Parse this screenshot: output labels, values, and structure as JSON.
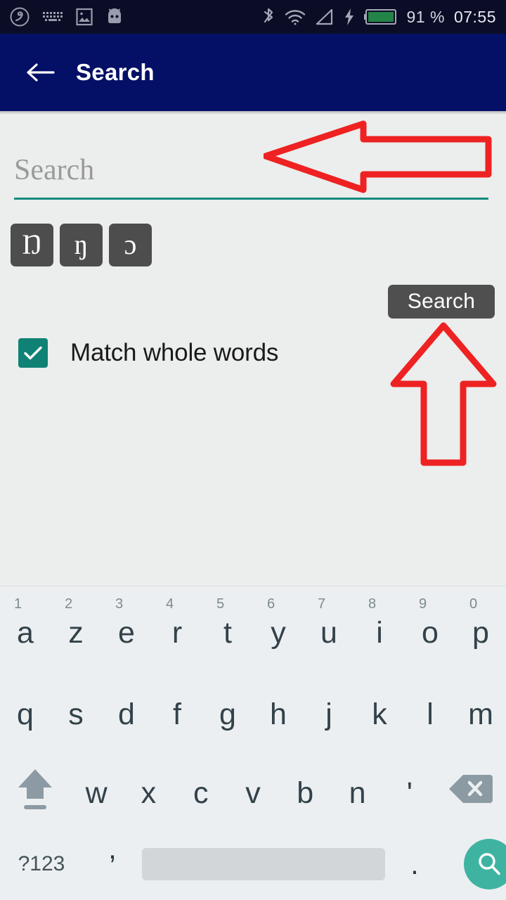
{
  "status_bar": {
    "left_icons": [
      "app-swirl-icon",
      "keyboard-icon",
      "image-icon",
      "android-head-icon"
    ],
    "right_icons": [
      "bluetooth-icon",
      "wifi-icon",
      "signal-icon",
      "charging-bolt-icon",
      "battery-icon"
    ],
    "battery_percent": "91 %",
    "clock": "07:55",
    "background_color": "#0b0d26",
    "battery_fill_color": "#2a9d4e"
  },
  "app_bar": {
    "back_icon": "arrow-left-icon",
    "title": "Search",
    "background_color": "#041066",
    "text_color": "#ffffff"
  },
  "search": {
    "placeholder": "Search",
    "value": "",
    "underline_color": "#118a7e",
    "special_chars": [
      "Ŋ",
      "ŋ",
      "ɔ"
    ],
    "search_button_label": "Search",
    "search_button_color": "#4f4f4f"
  },
  "options": {
    "match_whole_words_label": "Match whole words",
    "match_whole_words_checked": true,
    "checkbox_color": "#0f8275"
  },
  "annotations": {
    "color": "#ee2222",
    "arrow_left": "left-pointing-arrow",
    "arrow_up": "up-pointing-arrow"
  },
  "keyboard": {
    "layout": "AZERTY",
    "background_color": "#eceff1",
    "row1": [
      {
        "key": "a",
        "hint": "1"
      },
      {
        "key": "z",
        "hint": "2"
      },
      {
        "key": "e",
        "hint": "3"
      },
      {
        "key": "r",
        "hint": "4"
      },
      {
        "key": "t",
        "hint": "5"
      },
      {
        "key": "y",
        "hint": "6"
      },
      {
        "key": "u",
        "hint": "7"
      },
      {
        "key": "i",
        "hint": "8"
      },
      {
        "key": "o",
        "hint": "9"
      },
      {
        "key": "p",
        "hint": "0"
      }
    ],
    "row2": [
      {
        "key": "q"
      },
      {
        "key": "s"
      },
      {
        "key": "d"
      },
      {
        "key": "f"
      },
      {
        "key": "g"
      },
      {
        "key": "h"
      },
      {
        "key": "j"
      },
      {
        "key": "k"
      },
      {
        "key": "l"
      },
      {
        "key": "m"
      }
    ],
    "row3": {
      "shift": "shift-icon",
      "keys": [
        {
          "key": "w"
        },
        {
          "key": "x"
        },
        {
          "key": "c"
        },
        {
          "key": "v"
        },
        {
          "key": "b"
        },
        {
          "key": "n"
        },
        {
          "key": "'"
        }
      ],
      "backspace": "backspace-icon"
    },
    "row4": {
      "symbols_label": "?123",
      "comma": ",",
      "space": "",
      "period": ".",
      "enter_icon": "search-icon",
      "enter_color": "#3fb3a2"
    }
  }
}
